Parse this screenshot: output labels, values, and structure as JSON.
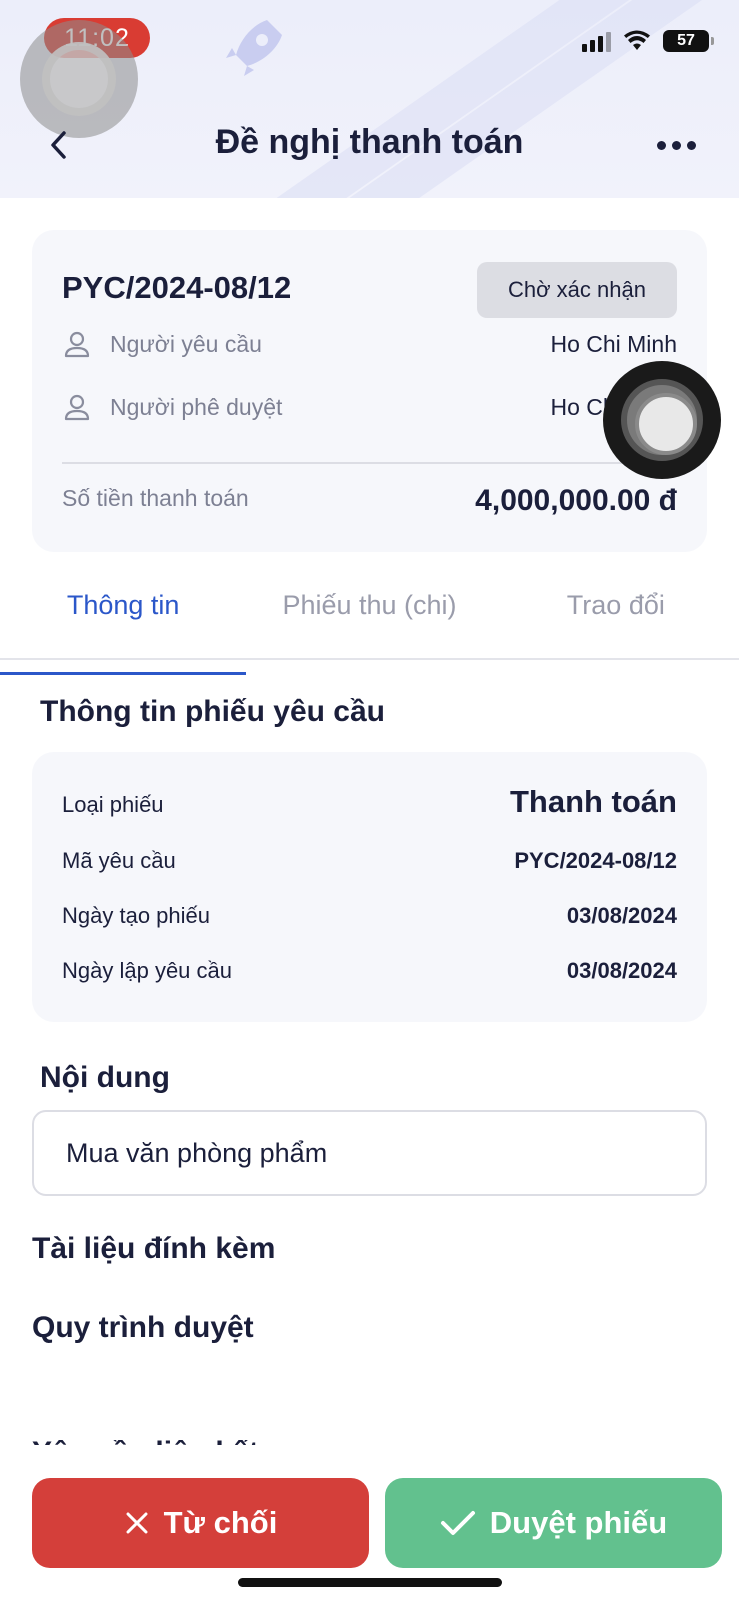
{
  "status_bar": {
    "time": "11:02",
    "battery": "57",
    "icons": [
      "signal-icon",
      "wifi-icon",
      "battery-icon"
    ]
  },
  "nav": {
    "title": "Đề nghị thanh toán",
    "back_icon": "chevron-left-icon",
    "more_icon": "more-horizontal-icon"
  },
  "summary": {
    "code": "PYC/2024-08/12",
    "status": "Chờ xác nhận",
    "requester_label": "Người yêu cầu",
    "requester_value": "Ho Chi Minh",
    "approver_label": "Người phê duyệt",
    "approver_value": "Ho Chi Minh",
    "amount_label": "Số tiền thanh toán",
    "amount_value": "4,000,000.00 đ"
  },
  "tabs": [
    {
      "label": "Thông tin",
      "active": true
    },
    {
      "label": "Phiếu thu (chi)",
      "active": false
    },
    {
      "label": "Trao đổi",
      "active": false
    }
  ],
  "info": {
    "title": "Thông tin phiếu yêu cầu",
    "rows": [
      {
        "key": "Loại phiếu",
        "value": "Thanh toán"
      },
      {
        "key": "Mã yêu cầu",
        "value": "PYC/2024-08/12"
      },
      {
        "key": "Ngày tạo phiếu",
        "value": "03/08/2024"
      },
      {
        "key": "Ngày lập yêu cầu",
        "value": "03/08/2024"
      }
    ]
  },
  "content": {
    "title": "Nội dung",
    "value": "Mua văn phòng phẩm"
  },
  "attachments": {
    "title": "Tài liệu đính kèm"
  },
  "workflow": {
    "title": "Quy trình duyệt"
  },
  "partial_section": {
    "title": "Yêu cầu liên kết"
  },
  "actions": {
    "reject_label": "Từ chối",
    "approve_label": "Duyệt phiếu"
  },
  "colors": {
    "accent": "#2b57c9",
    "reject": "#d43f3a",
    "approve": "#62c18e",
    "status_pill": "#d93c33"
  }
}
